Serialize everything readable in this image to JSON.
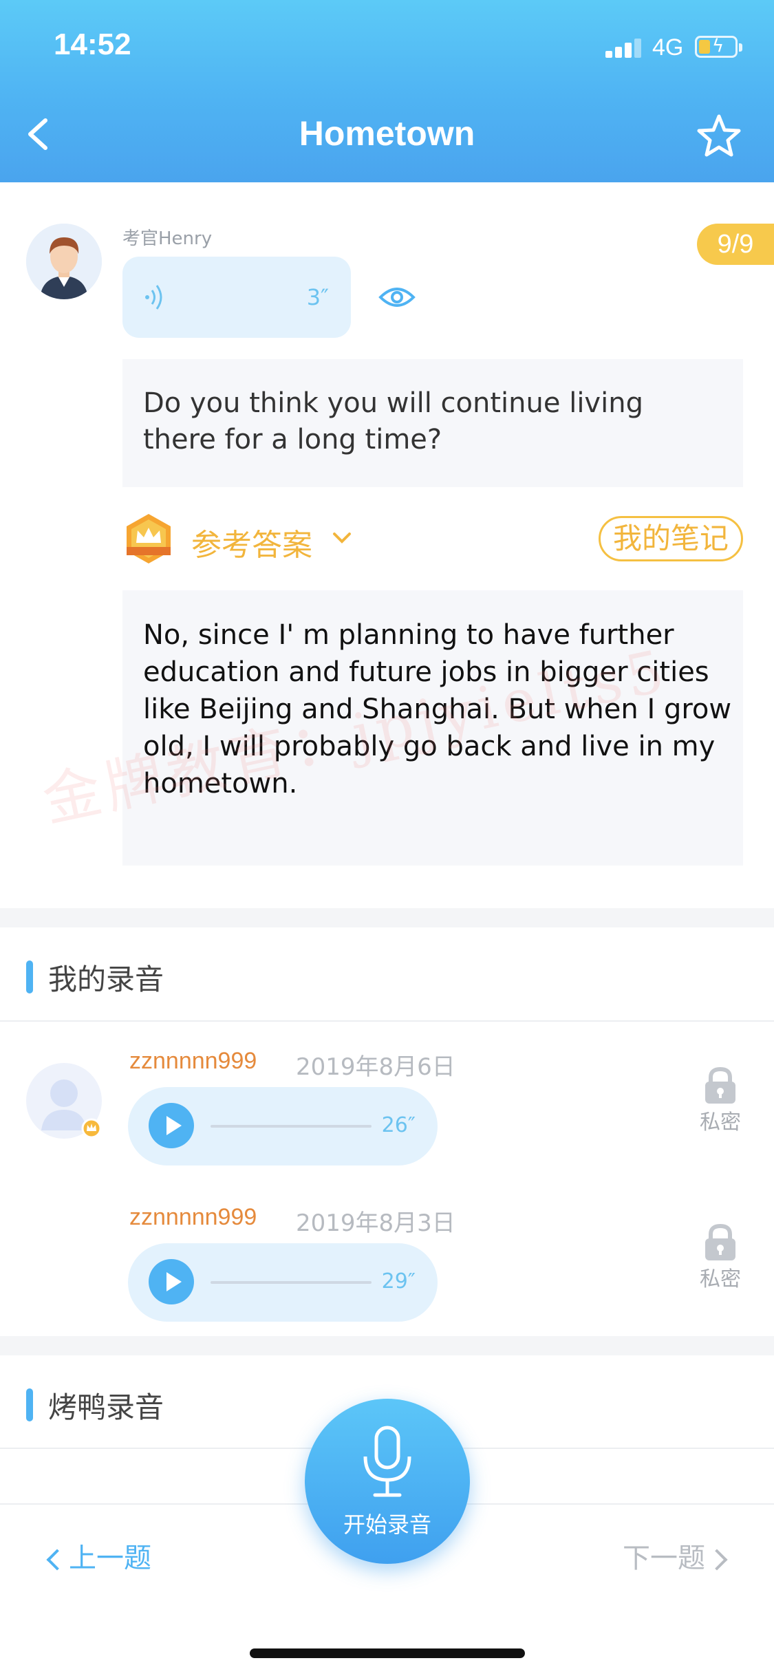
{
  "status": {
    "time": "14:52",
    "network": "4G"
  },
  "header": {
    "title": "Hometown"
  },
  "examiner": {
    "name": "考官Henry",
    "audio_duration": "3″",
    "progress": "9/9"
  },
  "question": {
    "text": "Do you think you will continue living there for a long time?"
  },
  "reference": {
    "label": "参考答案",
    "notes_label": "我的笔记",
    "answer": "No, since I' m planning to have further education and future jobs in bigger cities like Beijing and Shanghai. But when I grow old, I will probably go back and live in my hometown."
  },
  "watermark": "金牌教育：jpjyielts5",
  "my_recordings": {
    "title": "我的录音",
    "items": [
      {
        "user": "zznnnnn999",
        "date": "2019年8月6日",
        "duration": "26″",
        "privacy": "私密"
      },
      {
        "user": "zznnnnn999",
        "date": "2019年8月3日",
        "duration": "29″",
        "privacy": "私密"
      }
    ]
  },
  "duck_recordings": {
    "title": "烤鸭录音"
  },
  "footer": {
    "prev": "上一题",
    "next": "下一题",
    "record": "开始录音"
  },
  "colors": {
    "accent": "#4fb3f3",
    "gold": "#f2b53c",
    "username": "#e58a3c"
  }
}
